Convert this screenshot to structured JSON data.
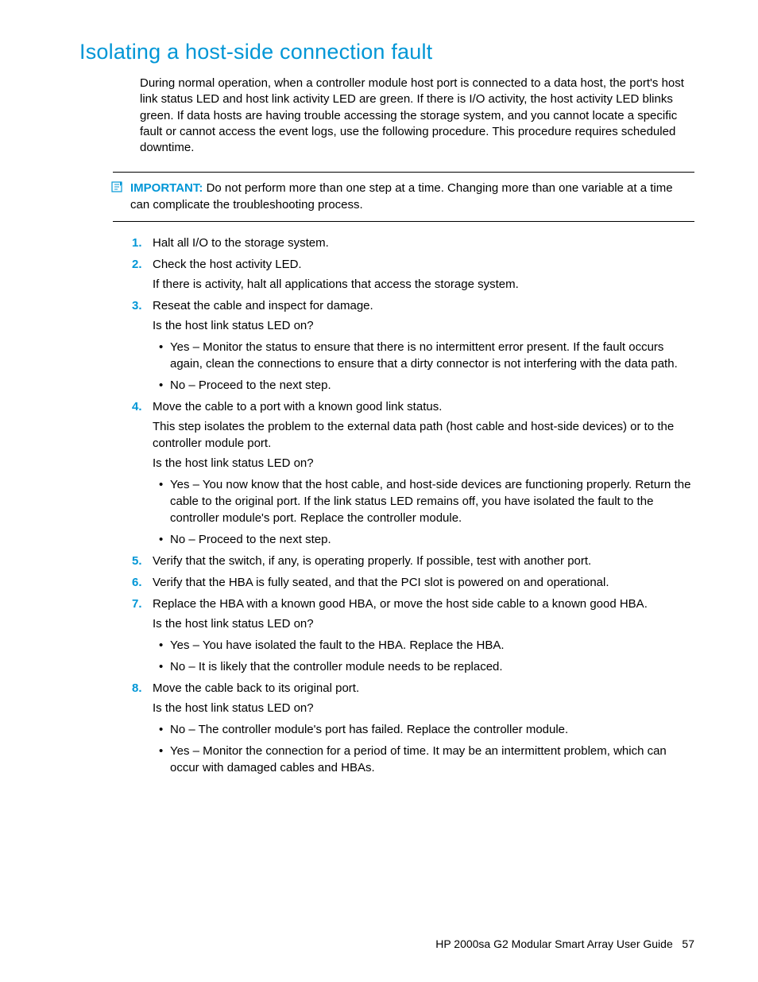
{
  "heading": "Isolating a host-side connection fault",
  "intro": "During normal operation, when a controller module host port is connected to a data host, the port's host link status LED and host link activity LED are green. If there is I/O activity, the host activity LED blinks green. If data hosts are having trouble accessing the storage system, and you cannot locate a specific fault or cannot access the event logs, use the following procedure. This procedure requires scheduled downtime.",
  "note": {
    "label": "IMPORTANT:",
    "text": "Do not perform more than one step at a time. Changing more than one variable at a time can complicate the troubleshooting process."
  },
  "steps": [
    {
      "text": "Halt all I/O to the storage system."
    },
    {
      "text": "Check the host activity LED.",
      "sub": [
        "If there is activity, halt all applications that access the storage system."
      ]
    },
    {
      "text": "Reseat the cable and inspect for damage.",
      "sub": [
        "Is the host link status LED on?"
      ],
      "bullets": [
        "Yes – Monitor the status to ensure that there is no intermittent error present. If the fault occurs again, clean the connections to ensure that a dirty connector is not interfering with the data path.",
        "No – Proceed to the next step."
      ]
    },
    {
      "text": "Move the cable to a port with a known good link status.",
      "sub": [
        "This step isolates the problem to the external data path (host cable and host-side devices) or to the controller module port.",
        "Is the host link status LED on?"
      ],
      "bullets": [
        "Yes – You now know that the host cable, and host-side devices are functioning properly. Return the cable to the original port. If the link status LED remains off, you have isolated the fault to the controller module's port. Replace the controller module.",
        "No – Proceed to the next step."
      ]
    },
    {
      "text": "Verify that the switch, if any, is operating properly. If possible, test with another port."
    },
    {
      "text": "Verify that the HBA is fully seated, and that the PCI slot is powered on and operational."
    },
    {
      "text": "Replace the HBA with a known good HBA, or move the host side cable to a known good HBA.",
      "sub": [
        "Is the host link status LED on?"
      ],
      "bullets": [
        "Yes – You have isolated the fault to the HBA. Replace the HBA.",
        "No – It is likely that the controller module needs to be replaced."
      ]
    },
    {
      "text": "Move the cable back to its original port.",
      "sub": [
        "Is the host link status LED on?"
      ],
      "bullets": [
        "No – The controller module's port has failed. Replace the controller module.",
        "Yes – Monitor the connection for a period of time. It may be an intermittent problem, which can occur with damaged cables and HBAs."
      ]
    }
  ],
  "footer": {
    "title": "HP 2000sa G2 Modular Smart Array User Guide",
    "page": "57"
  }
}
